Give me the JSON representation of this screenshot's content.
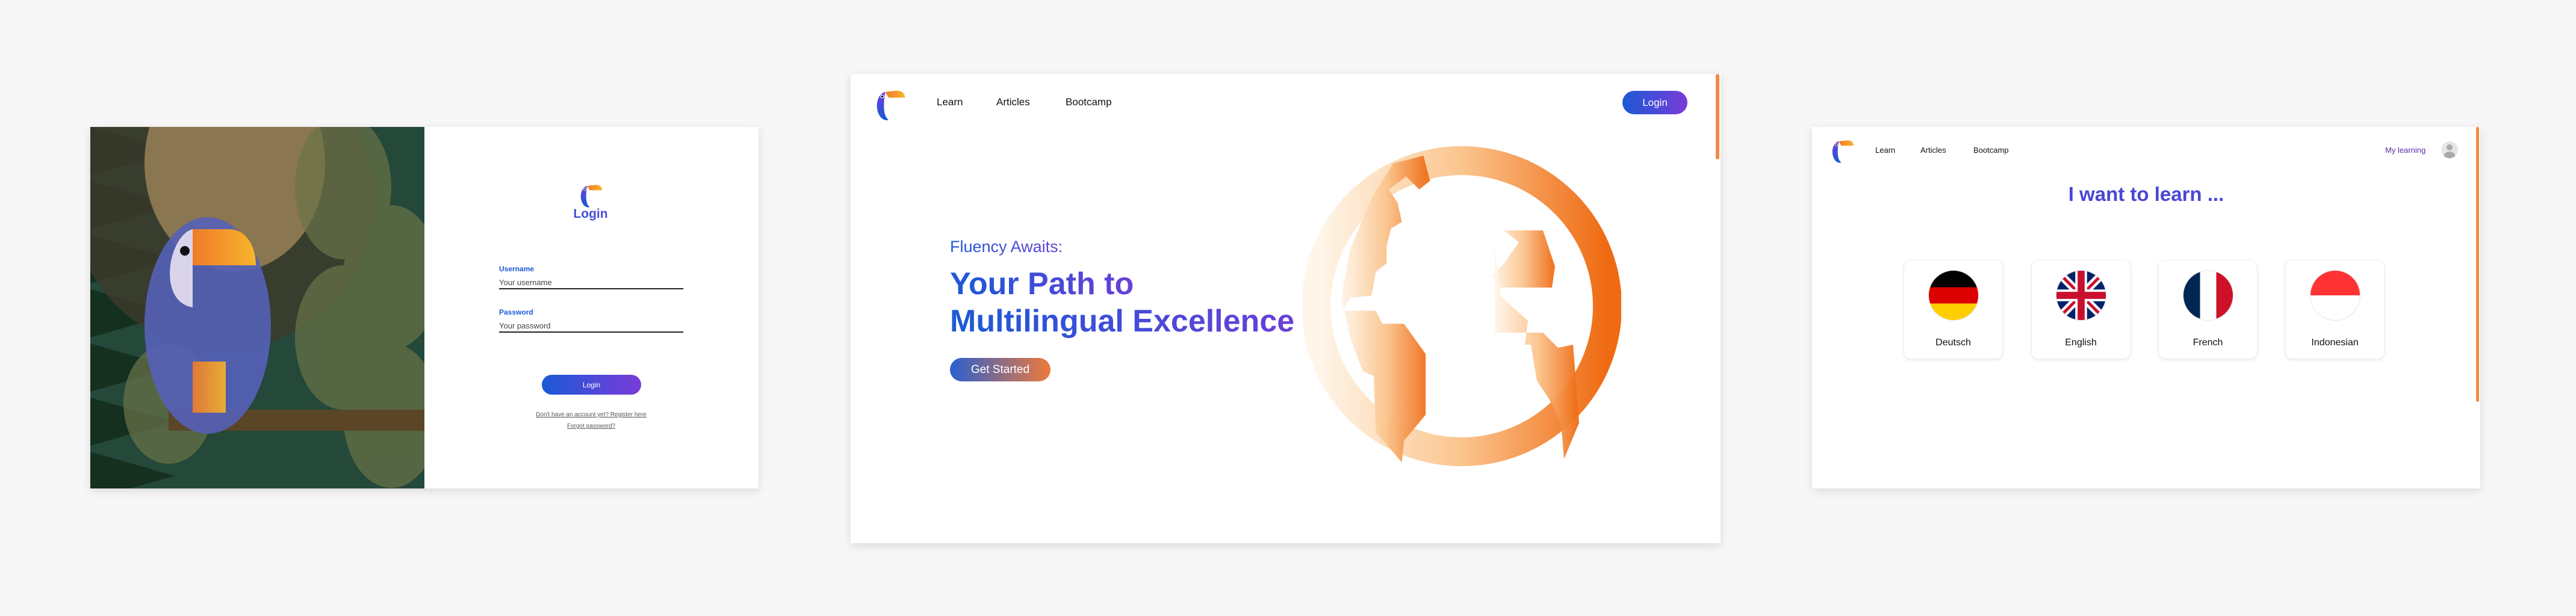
{
  "login_screen": {
    "title": "Login",
    "username_label": "Username",
    "username_placeholder": "Your username",
    "password_label": "Password",
    "password_placeholder": "Your password",
    "login_button": "Login",
    "register_link": "Don't have an account yet? Register here",
    "forgot_link": "Forgot password?"
  },
  "landing_screen": {
    "nav": [
      "Learn",
      "Articles",
      "Bootcamp"
    ],
    "login_button": "Login",
    "eyebrow": "Fluency Awaits:",
    "headline_line1": "Your Path to",
    "headline_line2": "Multilingual Excellence",
    "cta_button": "Get Started"
  },
  "language_screen": {
    "nav": [
      "Learn",
      "Articles",
      "Bootcamp"
    ],
    "my_learning": "My learning",
    "title": "I want to learn ...",
    "languages": [
      {
        "label": "Deutsch",
        "flag": "germany-flag-icon"
      },
      {
        "label": "English",
        "flag": "uk-flag-icon"
      },
      {
        "label": "French",
        "flag": "france-flag-icon"
      },
      {
        "label": "Indonesian",
        "flag": "indonesia-flag-icon"
      }
    ]
  },
  "colors": {
    "primary_blue": "#1a5ad6",
    "purple": "#6a3fd8",
    "orange": "#f07a2a",
    "background": "#f7f7f7"
  }
}
